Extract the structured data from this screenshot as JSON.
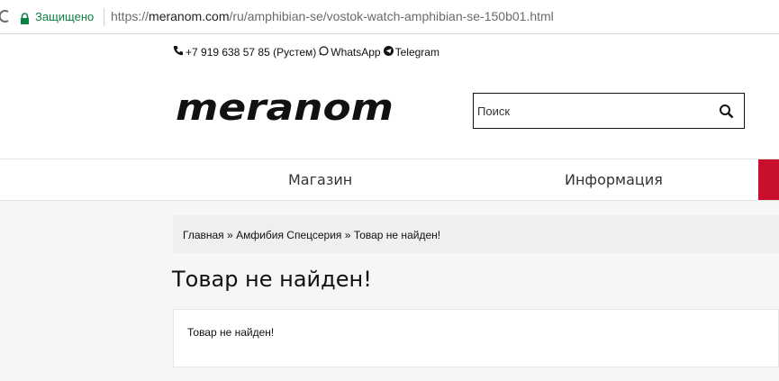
{
  "browser": {
    "secure_label": "Защищено",
    "url_scheme": "https://",
    "url_host": "meranom.com",
    "url_path": "/ru/amphibian-se/vostok-watch-amphibian-se-150b01.html"
  },
  "contacts": {
    "phone": "+7 919 638 57 85 (Рустем)",
    "whatsapp": "WhatsApp",
    "telegram": "Telegram"
  },
  "logo": {
    "text": "meranom"
  },
  "search": {
    "placeholder": "Поиск"
  },
  "nav": {
    "items": [
      {
        "label": "Магазин"
      },
      {
        "label": "Информация"
      }
    ]
  },
  "breadcrumb": {
    "items": [
      {
        "label": "Главная"
      },
      {
        "label": "Амфибия Спецсерия"
      },
      {
        "label": "Товар не найден!"
      }
    ],
    "separator": "»"
  },
  "page": {
    "title": "Товар не найден!",
    "message": "Товар не найден!"
  },
  "colors": {
    "accent_red": "#c8102e",
    "secure_green": "#0b8043"
  }
}
